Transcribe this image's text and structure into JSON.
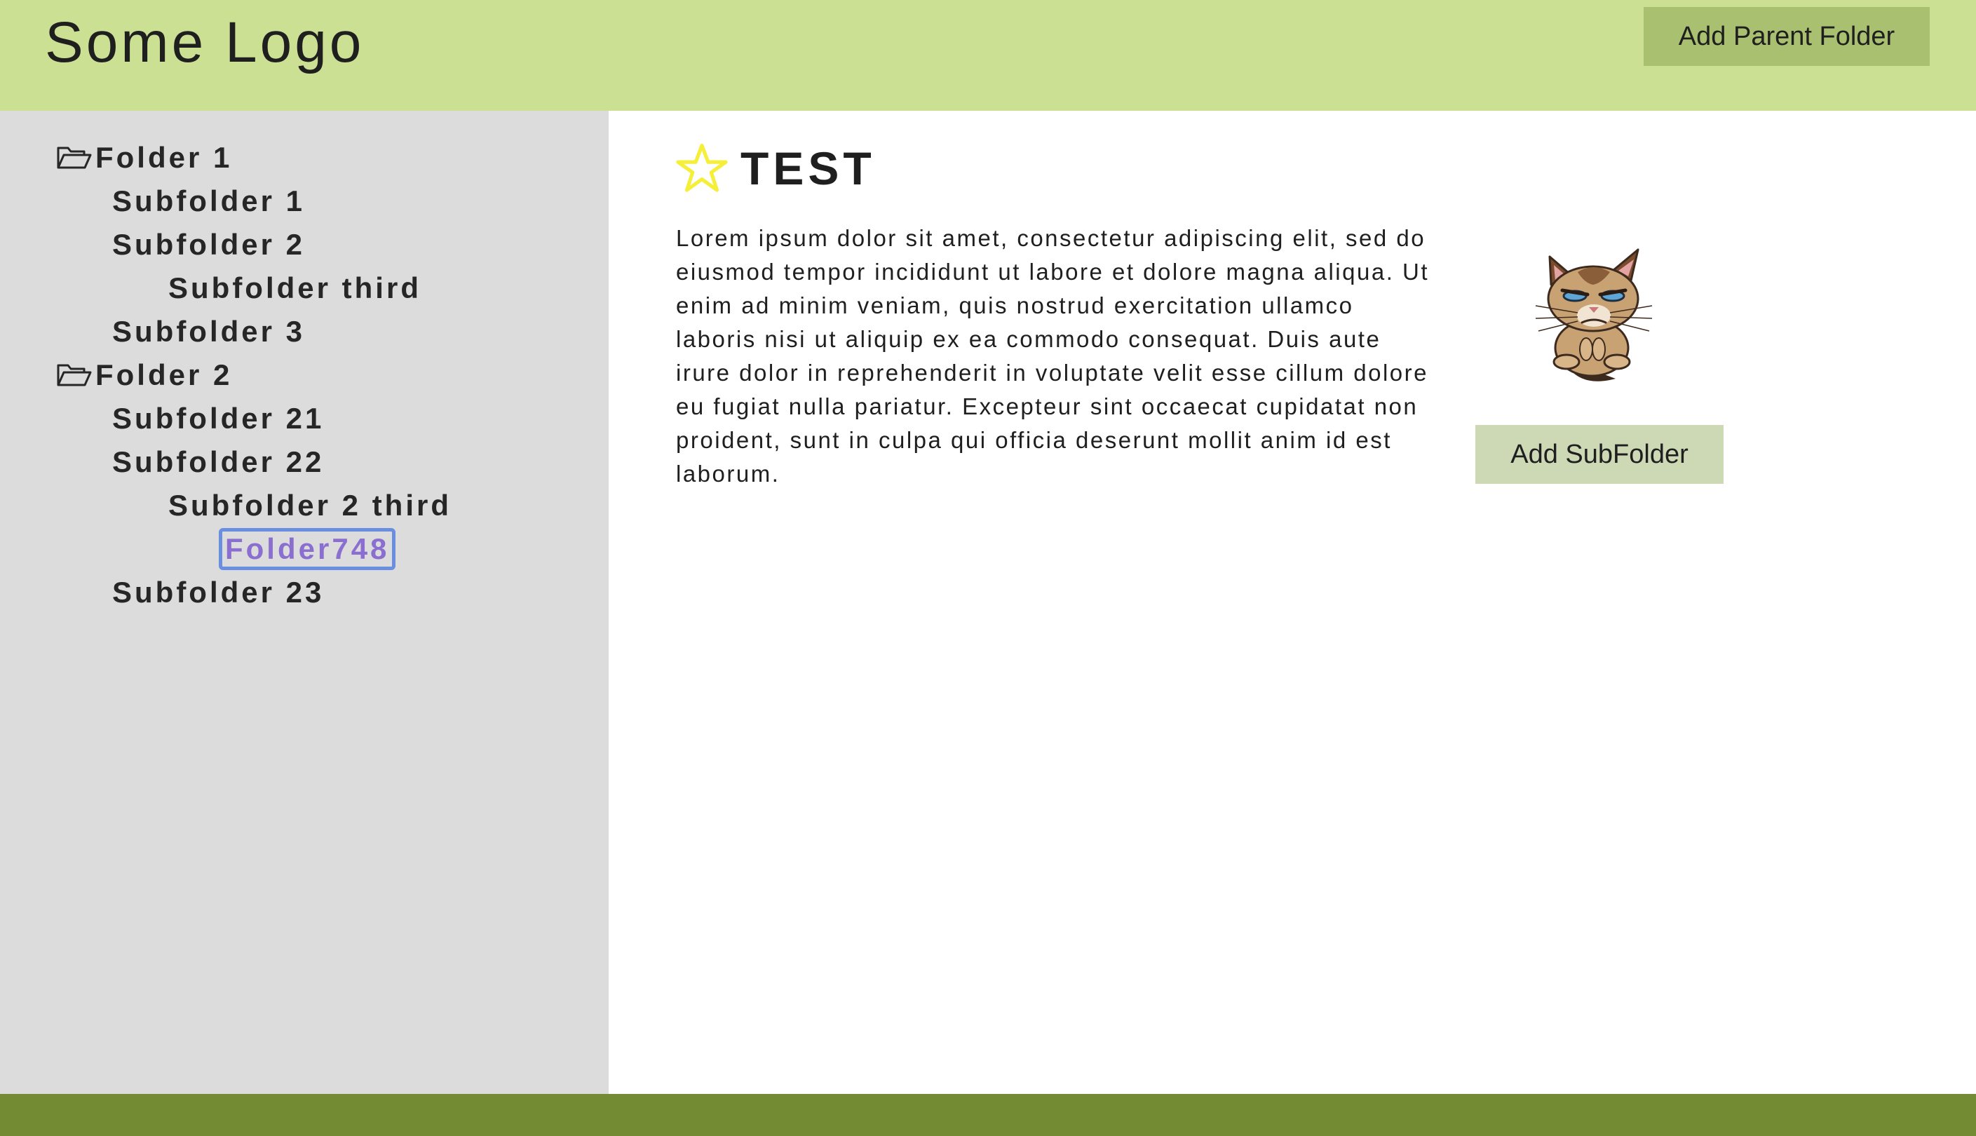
{
  "header": {
    "logo": "Some Logo",
    "add_parent_label": "Add Parent Folder"
  },
  "sidebar": {
    "items": [
      {
        "label": "Folder 1",
        "level": 0,
        "icon": "folder-open-icon"
      },
      {
        "label": "Subfolder 1",
        "level": 1
      },
      {
        "label": "Subfolder 2",
        "level": 1
      },
      {
        "label": "Subfolder third",
        "level": 2
      },
      {
        "label": "Subfolder 3",
        "level": 1
      },
      {
        "label": "Folder 2",
        "level": 0,
        "icon": "folder-open-icon"
      },
      {
        "label": "Subfolder 21",
        "level": 1
      },
      {
        "label": "Subfolder 22",
        "level": 1
      },
      {
        "label": "Subfolder 2 third",
        "level": 2
      },
      {
        "label": "Folder748",
        "level": 3,
        "selected": true
      },
      {
        "label": "Subfolder 23",
        "level": 1
      }
    ]
  },
  "main": {
    "title": "TEST",
    "title_icon": "star-icon",
    "body": "Lorem ipsum dolor sit amet, consectetur adipiscing elit, sed do eiusmod tempor incididunt ut labore et dolore magna aliqua. Ut enim ad minim veniam, quis nostrud exercitation ullamco laboris nisi ut aliquip ex ea commodo consequat. Duis aute irure dolor in reprehenderit in voluptate velit esse cillum dolore eu fugiat nulla pariatur. Excepteur sint occaecat cupidatat non proident, sunt in culpa qui officia deserunt mollit anim id est laborum.",
    "add_sub_label": "Add SubFolder"
  },
  "colors": {
    "header_bg": "#cbe093",
    "add_parent_bg": "#a8c070",
    "sidebar_bg": "#dcdcdc",
    "add_sub_bg": "#cdd8b5",
    "footer_bg": "#738c33",
    "star": "#f5ef3a",
    "selection_border": "#6b8fe0",
    "selection_text": "#8a6fd0"
  }
}
